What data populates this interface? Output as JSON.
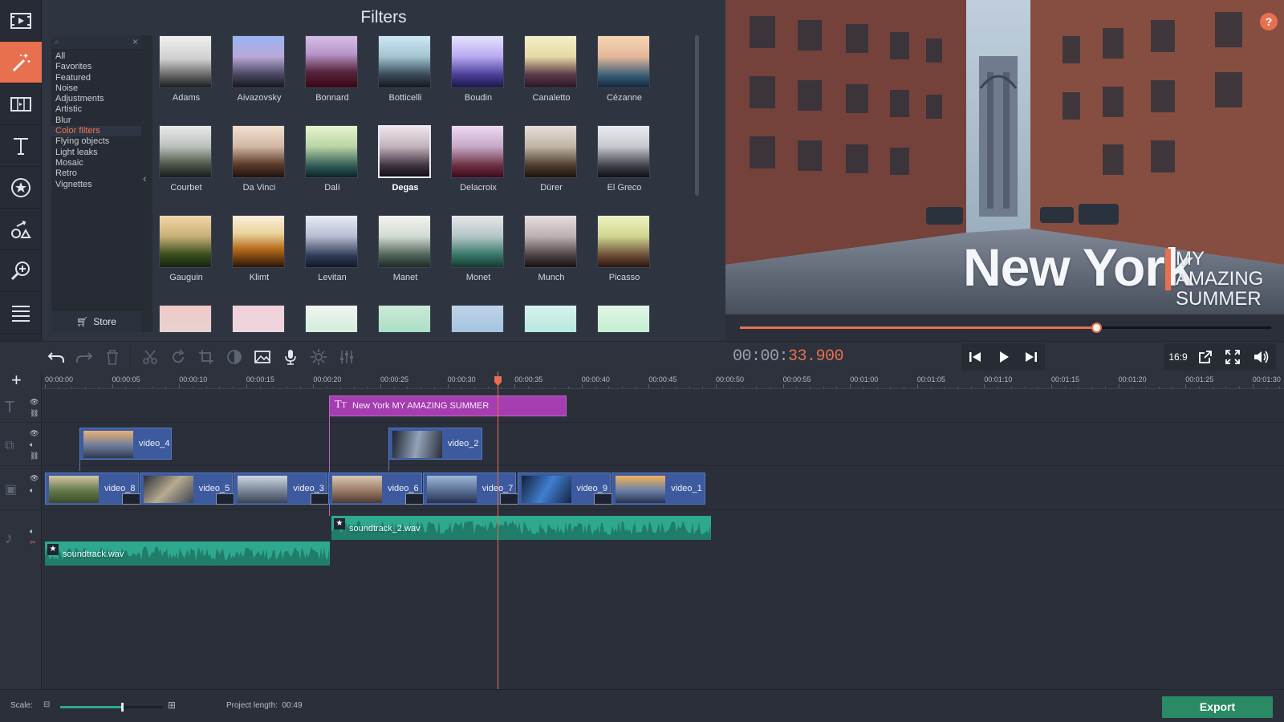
{
  "filters_panel": {
    "title": "Filters",
    "categories": [
      "All",
      "Favorites",
      "Featured",
      "Noise",
      "Adjustments",
      "Artistic",
      "Blur",
      "Color filters",
      "Flying objects",
      "Light leaks",
      "Mosaic",
      "Retro",
      "Vignettes"
    ],
    "selected_category": "Color filters",
    "store_label": "Store",
    "tiles": [
      {
        "name": "Adams",
        "grad": "linear-gradient(#f0f0f0,#cfcfcf 45%,#5a5a5a 80%,#1e1e1e)"
      },
      {
        "name": "Aivazovsky",
        "grad": "linear-gradient(#9ab5f5,#b8a9d8 40%,#4a4660 75%,#161620)"
      },
      {
        "name": "Bonnard",
        "grad": "linear-gradient(#d8bde8,#b795c8 35%,#57243c 70%,#3a0716)"
      },
      {
        "name": "Botticelli",
        "grad": "linear-gradient(#cfe7f4,#a3c4d2 40%,#3a4b58 75%,#15181c)"
      },
      {
        "name": "Boudin",
        "grad": "linear-gradient(#e6e2fb,#b9a9f2 40%,#4b3f9a 75%,#1c1848)"
      },
      {
        "name": "Canaletto",
        "grad": "linear-gradient(#f6efc8,#e5d9a4 40%,#5b3b4a 75%,#2c1528)"
      },
      {
        "name": "Cézanne",
        "grad": "linear-gradient(#f6d7b3,#e5b79a 40%,#335a74 78%,#14263a)"
      },
      {
        "name": "Courbet",
        "grad": "linear-gradient(#e8e9ea,#bcc0bc 40%,#4d5549 75%,#1a1c1a)"
      },
      {
        "name": "Da Vinci",
        "grad": "linear-gradient(#f2e0d0,#d2b8a4 40%,#5b3a2a 75%,#1f1410)"
      },
      {
        "name": "Dalí",
        "grad": "linear-gradient(#e7f4d0,#b9d4a4 40%,#2f5b56 78%,#0d2228)"
      },
      {
        "name": "Degas",
        "grad": "linear-gradient(#eee4ec,#c2b2ba 40%,#3e3440 78%,#151016)"
      },
      {
        "name": "Delacroix",
        "grad": "linear-gradient(#efdaf2,#c5a9c8 40%,#6b2e40 78%,#3a0b1b)"
      },
      {
        "name": "Dürer",
        "grad": "linear-gradient(#e7dfd8,#c1b4a6 40%,#4a3a2c 78%,#1b140e)"
      },
      {
        "name": "El Greco",
        "grad": "linear-gradient(#eaecef,#c5c9cf 40%,#3d4048 78%,#0f1014)"
      },
      {
        "name": "Gauguin",
        "grad": "linear-gradient(#f3d7a8,#c7b075 40%,#3c4f1f 75%,#142312)"
      },
      {
        "name": "Klimt",
        "grad": "linear-gradient(#fbeedb,#ead29a 35%,#b56a1a 65%,#2a140a)"
      },
      {
        "name": "Levitan",
        "grad": "linear-gradient(#e9ecf3,#b7bcd3 40%,#2f3b56 78%,#10182a)"
      },
      {
        "name": "Manet",
        "grad": "linear-gradient(#f4f2ef,#d4dcd2 40%,#54685d 75%,#1e2b28)"
      },
      {
        "name": "Monet",
        "grad": "linear-gradient(#e8e6ea,#b5c6c6 40%,#3a7a6b 75%,#133a30)"
      },
      {
        "name": "Munch",
        "grad": "linear-gradient(#e5dfdf,#bdb1b1 40%,#4a4040 78%,#171212)"
      },
      {
        "name": "Picasso",
        "grad": "linear-gradient(#eef2c3,#cfd68f 40%,#6a4a36 78%,#2b1611)"
      },
      {
        "name": "",
        "grad": "linear-gradient(#f1c7c7,#e4d6d2 60%,#e9e4e2)"
      },
      {
        "name": "",
        "grad": "linear-gradient(#f3cfd8,#ead7df 60%,#efe5e7)"
      },
      {
        "name": "",
        "grad": "linear-gradient(#f1f6ef,#cdecd7 60%,#bde8c9)"
      },
      {
        "name": "",
        "grad": "linear-gradient(#cbe9d8,#a6ddc2 60%,#86cea8)"
      },
      {
        "name": "",
        "grad": "linear-gradient(#bed3e9,#a2c1dd 60%,#93b3d1)"
      },
      {
        "name": "",
        "grad": "linear-gradient(#d7f2ec,#b2e7dc 60%,#96dccc)"
      },
      {
        "name": "",
        "grad": "linear-gradient(#e3f6e8,#bfeccd 60%,#a3e3b5)"
      }
    ],
    "selected_tile": "Degas"
  },
  "preview": {
    "help_icon": "?",
    "title_main": "New York",
    "title_sub_line1": "MY AMAZING",
    "title_sub_line2": "SUMMER",
    "scrub_progress": 0.67
  },
  "toolbar": {
    "buttons": [
      "undo-icon",
      "redo-icon",
      "trash-icon",
      "scissors-icon",
      "rotate-icon",
      "crop-icon",
      "color-adjust-icon",
      "image-icon",
      "microphone-icon",
      "settings-icon",
      "equalizer-icon"
    ],
    "timecode_dim": "00:00:",
    "timecode_accent": "33.900",
    "aspect_ratio": "16:9"
  },
  "timeline": {
    "ruler_labels": [
      "00:00:00",
      "00:00:05",
      "00:00:10",
      "00:00:15",
      "00:00:20",
      "00:00:25",
      "00:00:30",
      "00:00:35",
      "00:00:40",
      "00:00:45",
      "00:00:50",
      "00:00:55",
      "00:01:00",
      "00:01:05",
      "00:01:10",
      "00:01:15",
      "00:01:20",
      "00:01:25",
      "00:01:30"
    ],
    "title_clip": "New York MY AMAZING SUMMER",
    "overlay_clips": [
      "video_4",
      "video_2"
    ],
    "main_clips": [
      "video_8",
      "video_5",
      "video_3",
      "video_6",
      "video_7",
      "video_9",
      "video_1"
    ],
    "audio_clips": [
      "soundtrack_2.wav",
      "soundtrack.wav"
    ]
  },
  "bottom": {
    "scale_label": "Scale:",
    "scale_value": 0.6,
    "project_length_label": "Project length:",
    "project_length": "00:49",
    "export_label": "Export"
  },
  "colors": {
    "accent": "#e8704f",
    "clip_blue": "#3d5a9e",
    "title_purple": "#a53db0",
    "audio_teal": "#2fa890",
    "export_green": "#2a8a63"
  }
}
